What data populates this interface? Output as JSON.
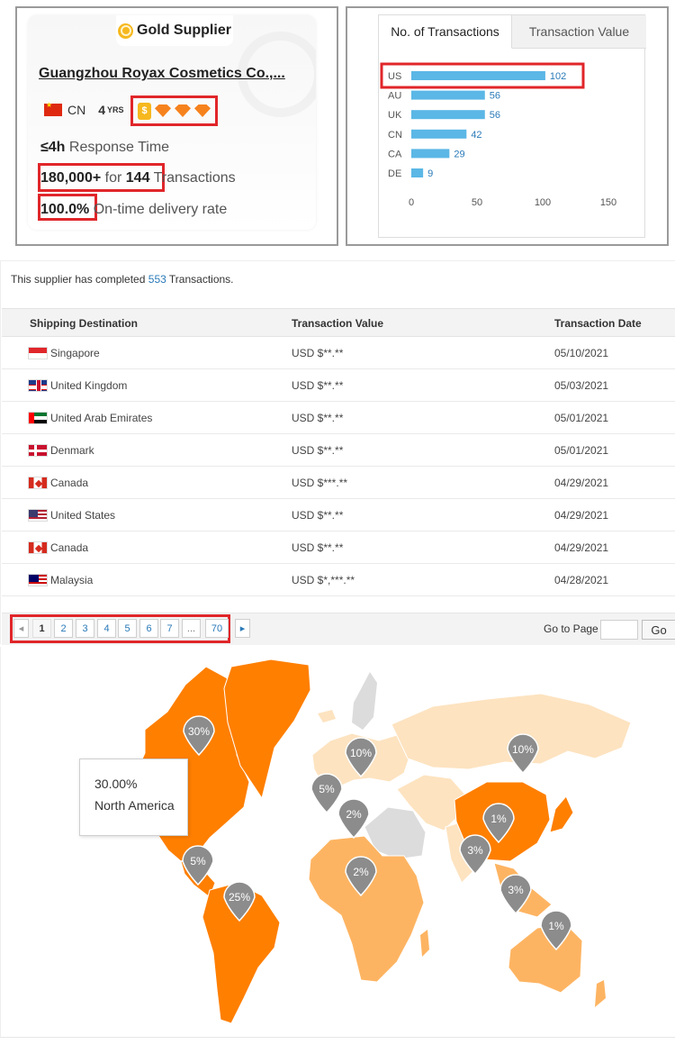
{
  "supplier": {
    "badge_label": "Gold Supplier",
    "name": "Guangzhou Royax Cosmetics Co.,...",
    "country": "CN",
    "years": "4",
    "years_label": "YRS",
    "response_time_value": "≤4h",
    "response_time_label": "Response Time",
    "transactions_amount": "180,000+",
    "transactions_for": "for",
    "transactions_count": "144",
    "transactions_label": "Transactions",
    "ontime_value": "100.0%",
    "ontime_label": "On-time delivery rate",
    "level_badges": [
      "coin-badge-icon",
      "diamond-badge-icon",
      "diamond-badge-icon",
      "diamond-badge-icon"
    ]
  },
  "chart_tabs": {
    "active": "No. of Transactions",
    "inactive": "Transaction Value"
  },
  "chart_data": {
    "type": "bar",
    "orientation": "horizontal",
    "categories": [
      "US",
      "AU",
      "UK",
      "CN",
      "CA",
      "DE"
    ],
    "values": [
      102,
      56,
      56,
      42,
      29,
      9
    ],
    "xlim": [
      0,
      150
    ],
    "xticks": [
      0,
      50,
      100,
      150
    ],
    "bar_color": "#5bb7e6",
    "highlighted_category": "US"
  },
  "transactions": {
    "summary_prefix": "This supplier has completed",
    "summary_count": "553",
    "summary_suffix": "Transactions.",
    "headers": [
      "Shipping Destination",
      "Transaction Value",
      "Transaction Date"
    ],
    "rows": [
      {
        "flag": "sg",
        "destination": "Singapore",
        "value": "USD $**.**",
        "date": "05/10/2021"
      },
      {
        "flag": "gb",
        "destination": "United Kingdom",
        "value": "USD $**.**",
        "date": "05/03/2021"
      },
      {
        "flag": "ae",
        "destination": "United Arab Emirates",
        "value": "USD $**.**",
        "date": "05/01/2021"
      },
      {
        "flag": "dk",
        "destination": "Denmark",
        "value": "USD $**.**",
        "date": "05/01/2021"
      },
      {
        "flag": "ca",
        "destination": "Canada",
        "value": "USD $***.**",
        "date": "04/29/2021"
      },
      {
        "flag": "us",
        "destination": "United States",
        "value": "USD $**.**",
        "date": "04/29/2021"
      },
      {
        "flag": "ca",
        "destination": "Canada",
        "value": "USD $**.**",
        "date": "04/29/2021"
      },
      {
        "flag": "my",
        "destination": "Malaysia",
        "value": "USD $*,***.**",
        "date": "04/28/2021"
      }
    ]
  },
  "pagination": {
    "prev": "◂",
    "pages": [
      "1",
      "2",
      "3",
      "4",
      "5",
      "6",
      "7",
      "...",
      "70"
    ],
    "current": "1",
    "next": "▸",
    "goto_label": "Go to Page",
    "goto_button": "Go"
  },
  "map": {
    "pins": [
      "30%",
      "10%",
      "10%",
      "5%",
      "2%",
      "1%",
      "3%",
      "5%",
      "2%",
      "25%",
      "3%",
      "1%"
    ],
    "tooltip_value": "30.00%",
    "tooltip_region": "North America",
    "colors": {
      "dark": "#ff7f00",
      "medium": "#fdb462",
      "light": "#fde3c0",
      "none": "#dcdcdc",
      "pin": "#8c8c8c"
    }
  }
}
